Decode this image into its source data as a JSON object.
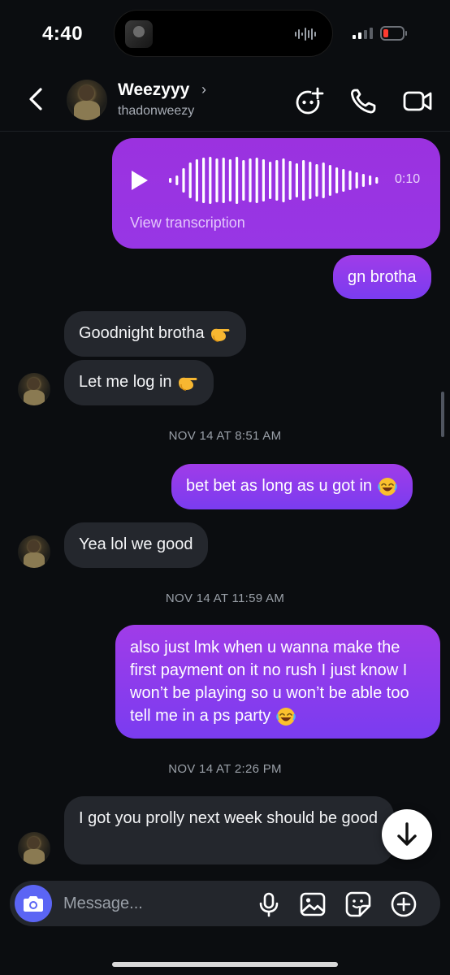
{
  "status_bar": {
    "time": "4:40"
  },
  "header": {
    "contact_name": "Weezyyy",
    "contact_chevron": "›",
    "contact_handle": "thadonweezy"
  },
  "voice_message": {
    "duration": "0:10",
    "transcription_label": "View transcription"
  },
  "messages": [
    {
      "text": "gn brotha"
    },
    {
      "text": "Goodnight brotha"
    },
    {
      "text": "Let me log in"
    },
    {
      "text": "bet bet as long as u got in"
    },
    {
      "text": "Yea lol we good"
    },
    {
      "text": "also just lmk when u wanna make the first payment on it no rush I just know I won’t be playing so u won’t be able too tell me in a ps party"
    },
    {
      "text": "I got you prolly next week should be good"
    }
  ],
  "timestamps": [
    "NOV 14 AT 8:51 AM",
    "NOV 14 AT 11:59 AM",
    "NOV 14 AT 2:26 PM"
  ],
  "composer": {
    "placeholder": "Message..."
  },
  "colors": {
    "outgoing_bubble": "#8f3ae8",
    "incoming_bubble": "#24272d",
    "camera_button": "#5b65f4",
    "background": "#0b0d10"
  },
  "icons": [
    "back-icon",
    "chevron-right-icon",
    "video-chat-icon",
    "phone-icon",
    "video-camera-icon",
    "play-icon",
    "camera-icon",
    "microphone-icon",
    "gallery-icon",
    "sticker-icon",
    "plus-icon",
    "arrow-down-icon"
  ]
}
